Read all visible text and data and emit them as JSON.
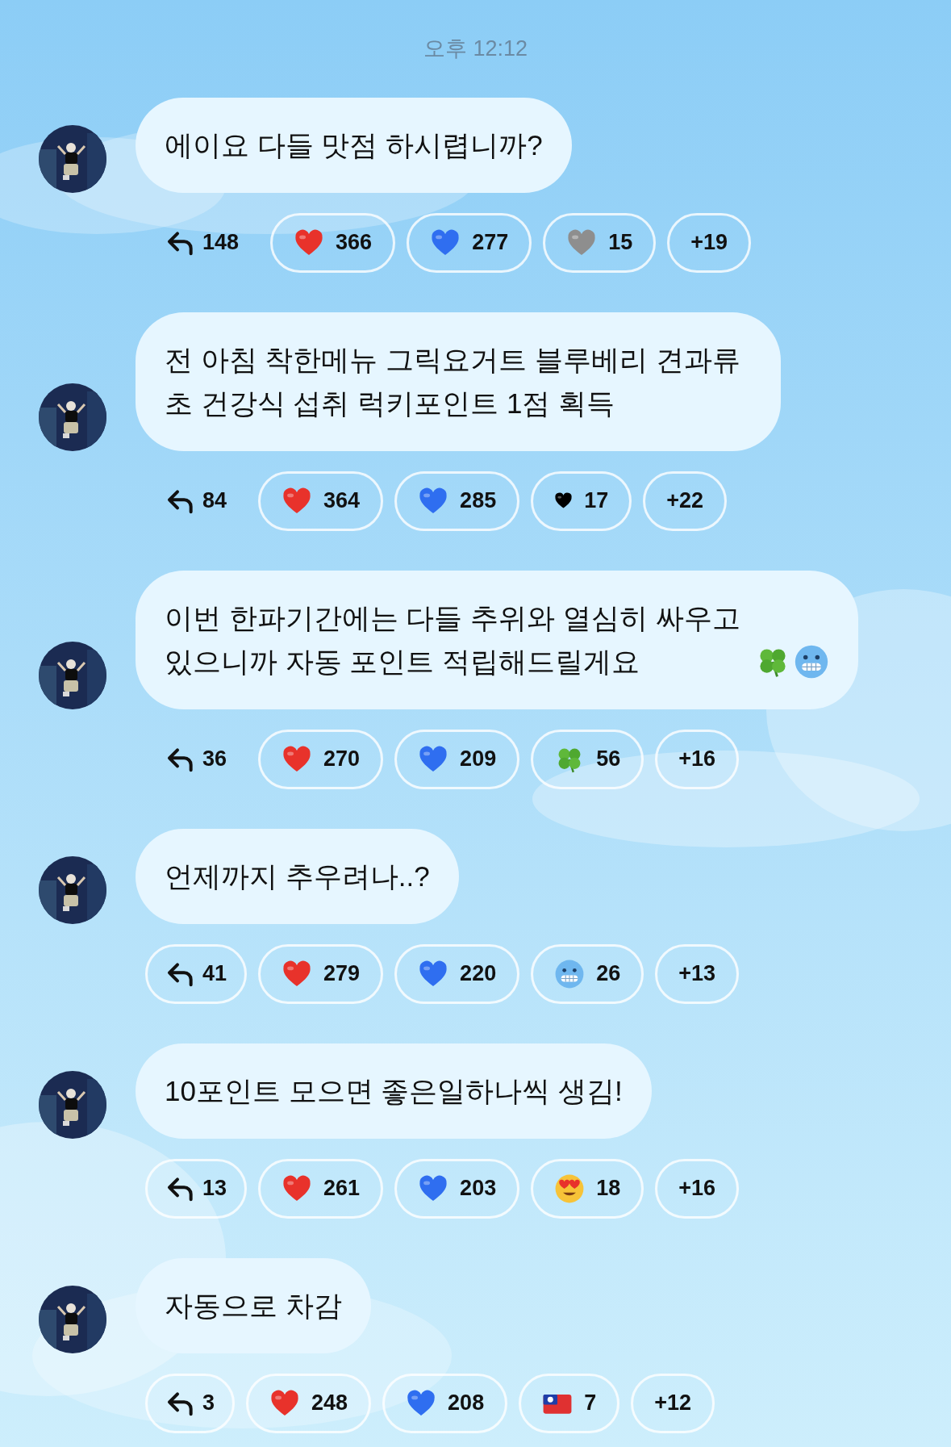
{
  "timestamp": "오후 12:12",
  "messages": [
    {
      "text": "에이요 다들 맛점 하시렵니까?",
      "reply": {
        "count": "148",
        "outlined": false
      },
      "reactions": [
        {
          "kind": "heart",
          "color": "#e8322b",
          "count": "366"
        },
        {
          "kind": "heart",
          "color": "#2f6ef0",
          "count": "277"
        },
        {
          "kind": "heart",
          "color": "#8e8e8e",
          "count": "15"
        },
        {
          "kind": "more",
          "count": "+19"
        }
      ]
    },
    {
      "text": "전 아침 착한메뉴 그릭요거트 블루베리 견과류초 건강식 섭취 럭키포인트 1점 획득",
      "reply": {
        "count": "84",
        "outlined": false
      },
      "reactions": [
        {
          "kind": "heart",
          "color": "#e8322b",
          "count": "364"
        },
        {
          "kind": "heart",
          "color": "#2f6ef0",
          "count": "285"
        },
        {
          "kind": "small-heart",
          "color": "#000000",
          "count": "17"
        },
        {
          "kind": "more",
          "count": "+22"
        }
      ]
    },
    {
      "text": "이번 한파기간에는 다들 추위와 열심히 싸우고 있으니까 자동 포인트 적립해드릴게요",
      "trailing_icons": [
        {
          "kind": "clover"
        },
        {
          "kind": "cold-face"
        }
      ],
      "reply": {
        "count": "36",
        "outlined": false
      },
      "reactions": [
        {
          "kind": "heart",
          "color": "#e8322b",
          "count": "270"
        },
        {
          "kind": "heart",
          "color": "#2f6ef0",
          "count": "209"
        },
        {
          "kind": "clover",
          "count": "56"
        },
        {
          "kind": "more",
          "count": "+16"
        }
      ]
    },
    {
      "text": "언제까지 추우려나..?",
      "reply": {
        "count": "41",
        "outlined": true
      },
      "reactions": [
        {
          "kind": "heart",
          "color": "#e8322b",
          "count": "279"
        },
        {
          "kind": "heart",
          "color": "#2f6ef0",
          "count": "220"
        },
        {
          "kind": "cold-face",
          "count": "26"
        },
        {
          "kind": "more",
          "count": "+13"
        }
      ]
    },
    {
      "text": "10포인트 모으면 좋은일하나씩 생김!",
      "reply": {
        "count": "13",
        "outlined": true
      },
      "reactions": [
        {
          "kind": "heart",
          "color": "#e8322b",
          "count": "261"
        },
        {
          "kind": "heart",
          "color": "#2f6ef0",
          "count": "203"
        },
        {
          "kind": "heart-eyes",
          "count": "18"
        },
        {
          "kind": "more",
          "count": "+16"
        }
      ]
    },
    {
      "text": "자동으로 차감",
      "reply": {
        "count": "3",
        "outlined": true
      },
      "reactions": [
        {
          "kind": "heart",
          "color": "#e8322b",
          "count": "248"
        },
        {
          "kind": "heart",
          "color": "#2f6ef0",
          "count": "208"
        },
        {
          "kind": "flag",
          "count": "7"
        },
        {
          "kind": "more",
          "count": "+12"
        }
      ]
    }
  ]
}
